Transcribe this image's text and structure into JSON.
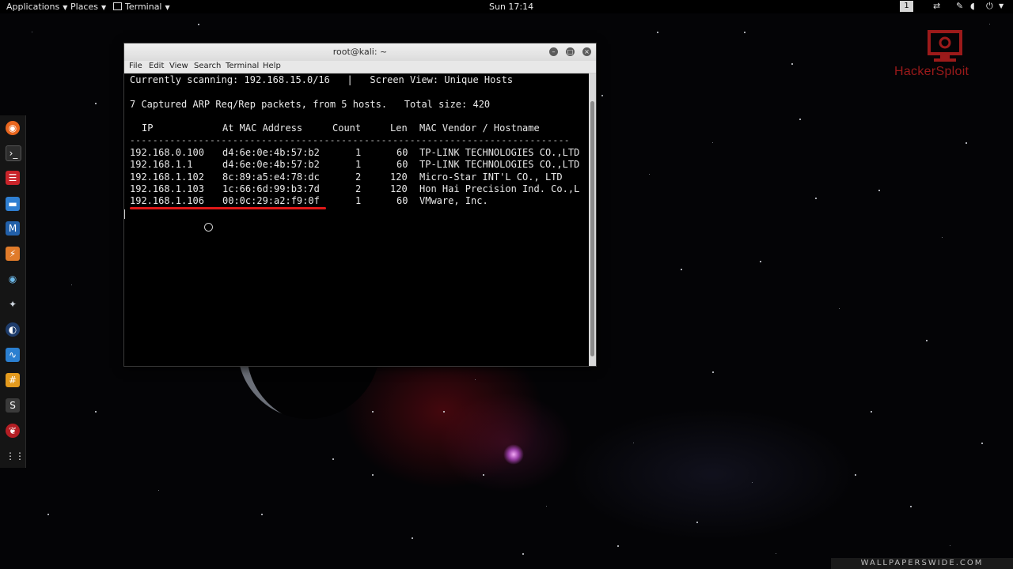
{
  "topbar": {
    "applications": "Applications",
    "places": "Places",
    "terminal": "Terminal",
    "clock": "Sun 17:14",
    "workspace": "1"
  },
  "window": {
    "title": "root@kali: ~",
    "menu": [
      "File",
      "Edit",
      "View",
      "Search",
      "Terminal",
      "Help"
    ]
  },
  "netdiscover": {
    "status_line": "Currently scanning: 192.168.15.0/16   |   Screen View: Unique Hosts",
    "summary_line": "7 Captured ARP Req/Rep packets, from 5 hosts.   Total size: 420",
    "headers": [
      "IP",
      "At MAC Address",
      "Count",
      "Len",
      "MAC Vendor / Hostname"
    ],
    "separator": "-----------------------------------------------------------------------------",
    "rows": [
      {
        "ip": "192.168.0.100",
        "mac": "d4:6e:0e:4b:57:b2",
        "count": "1",
        "len": "60",
        "vendor": "TP-LINK TECHNOLOGIES CO.,LTD"
      },
      {
        "ip": "192.168.1.1",
        "mac": "d4:6e:0e:4b:57:b2",
        "count": "1",
        "len": "60",
        "vendor": "TP-LINK TECHNOLOGIES CO.,LTD"
      },
      {
        "ip": "192.168.1.102",
        "mac": "8c:89:a5:e4:78:dc",
        "count": "2",
        "len": "120",
        "vendor": "Micro-Star INT'L CO., LTD"
      },
      {
        "ip": "192.168.1.103",
        "mac": "1c:66:6d:99:b3:7d",
        "count": "2",
        "len": "120",
        "vendor": "Hon Hai Precision Ind. Co.,L"
      },
      {
        "ip": "192.168.1.106",
        "mac": "00:0c:29:a2:f9:0f",
        "count": "1",
        "len": "60",
        "vendor": "VMware, Inc."
      }
    ]
  },
  "branding": {
    "logo_text": "HackerSploit",
    "wallpaper_credit": "WALLPAPERSWIDE.COM"
  },
  "colors": {
    "highlight_underline": "#e01818",
    "logo_red": "#9c1a1a"
  }
}
